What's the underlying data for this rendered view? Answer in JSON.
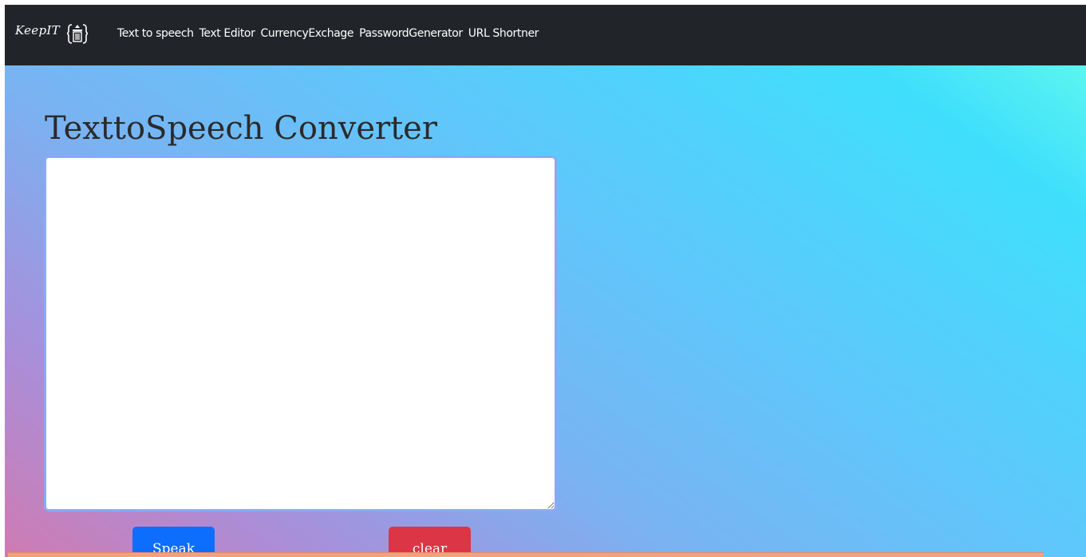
{
  "navbar": {
    "brand": "KeepIT",
    "brand_icon": "trash-bin-icon",
    "links": [
      "Text to speech",
      "Text Editor",
      "CurrencyExchage",
      "PasswordGenerator",
      "URL Shortner"
    ]
  },
  "main": {
    "title": "TexttoSpeech Converter",
    "textarea_value": "",
    "speak_label": "Speak",
    "clear_label": "clear"
  },
  "colors": {
    "navbar_bg": "#212529",
    "speak_button": "#0d6efd",
    "clear_button": "#dc3545",
    "gradient_start": "#cf7bb2",
    "gradient_end": "#5bf5f0"
  }
}
